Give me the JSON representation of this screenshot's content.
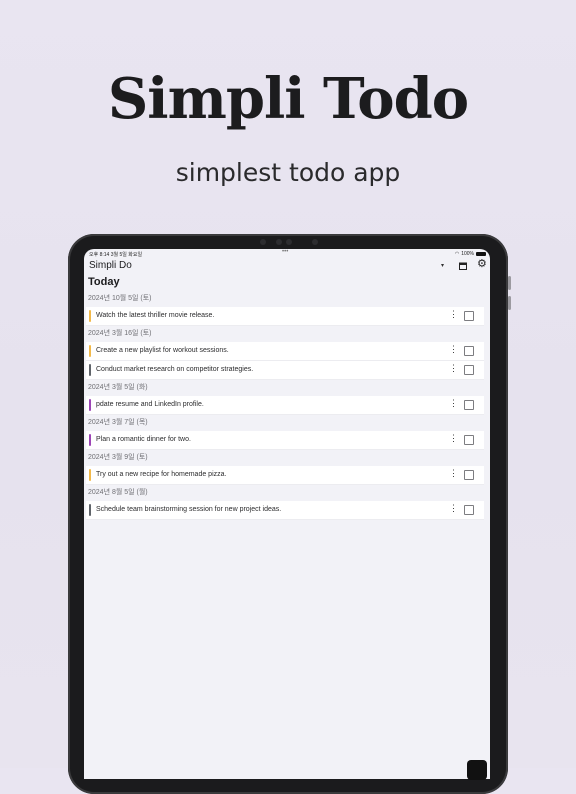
{
  "hero": {
    "title": "Simpli Todo",
    "subtitle": "simplest todo app"
  },
  "status_bar": {
    "time": "오후 8:14   3월 5일 화요일",
    "dots": "•••",
    "battery": "100%"
  },
  "app_bar": {
    "title": "Simpli Do",
    "dropdown_icon": "▾",
    "calendar_icon": "calendar-icon",
    "gear_icon": "⚙"
  },
  "section_title": "Today",
  "colors": {
    "orange": "#f2b94a",
    "gray": "#5f6369",
    "purple": "#9c45b5"
  },
  "groups": [
    {
      "date": "2024년 10월 5일 (토)",
      "items": [
        {
          "text": "Watch the latest thriller movie release.",
          "color": "#f2b94a"
        }
      ]
    },
    {
      "date": "2024년 3월 16일 (토)",
      "items": [
        {
          "text": "Create a new playlist for workout sessions.",
          "color": "#f2b94a"
        },
        {
          "text": "Conduct market research on competitor strategies.",
          "color": "#5f6369"
        }
      ]
    },
    {
      "date": "2024년 3월 5일 (화)",
      "items": [
        {
          "text": "pdate resume and LinkedIn profile.",
          "color": "#9c45b5"
        }
      ]
    },
    {
      "date": "2024년 3월 7일 (목)",
      "items": [
        {
          "text": "Plan a romantic dinner for two.",
          "color": "#9c45b5"
        }
      ]
    },
    {
      "date": "2024년 3월 9일 (토)",
      "items": [
        {
          "text": "Try out a new recipe for homemade pizza.",
          "color": "#f2b94a"
        }
      ]
    },
    {
      "date": "2024년 8월 5일 (월)",
      "items": [
        {
          "text": "Schedule team brainstorming session for new project ideas.",
          "color": "#5f6369"
        }
      ]
    }
  ],
  "item_menu_icon": "⋮"
}
